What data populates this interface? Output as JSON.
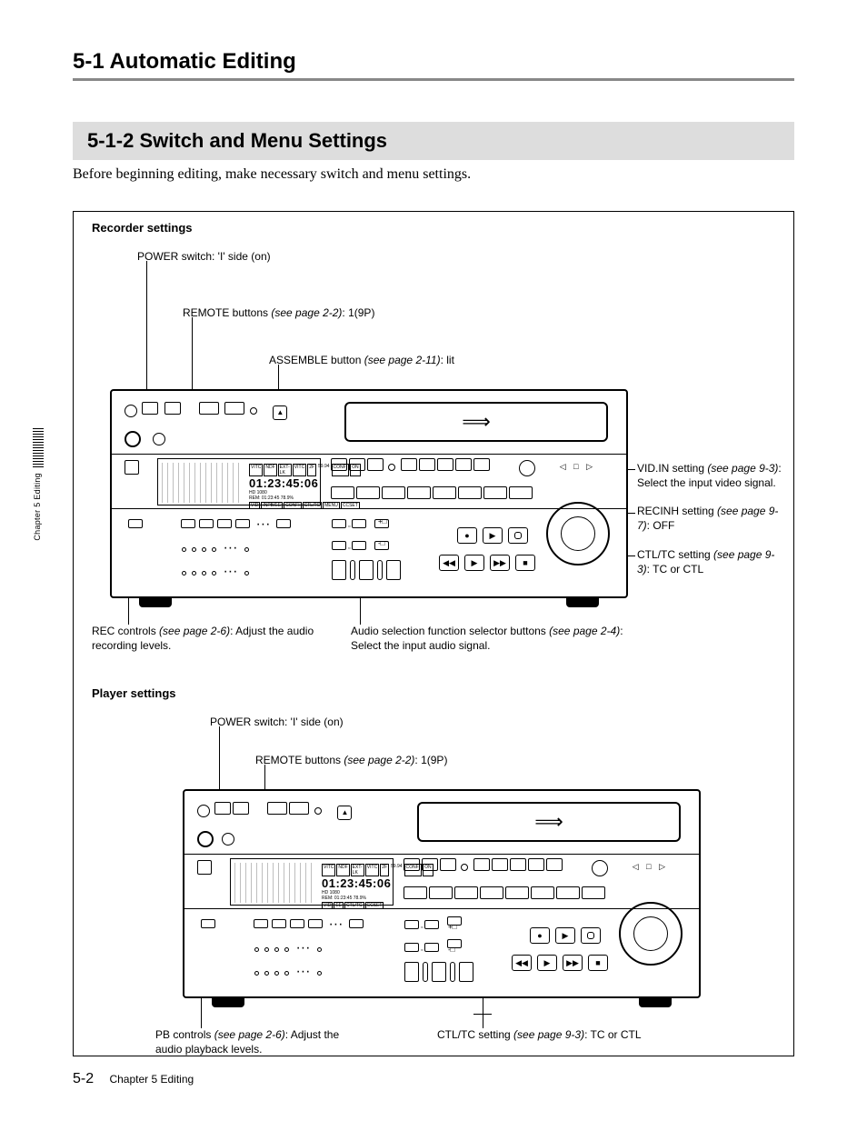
{
  "page": {
    "title": "5-1 Automatic Editing",
    "subsection": "5-1-2 Switch and Menu Settings",
    "intro": "Before beginning editing, make necessary switch and menu settings."
  },
  "recorder": {
    "heading": "Recorder settings",
    "callouts": {
      "power": {
        "text": "POWER switch: 'I' side (on)"
      },
      "remote": {
        "text": "REMOTE buttons ",
        "ref": "(see page 2-2)",
        "tail": ": 1(9P)"
      },
      "assemble": {
        "text": "ASSEMBLE button ",
        "ref": "(see page 2-11)",
        "tail": ": lit"
      },
      "vidin": {
        "text": "VID.IN setting ",
        "ref": "(see page 9-3)",
        "tail": ": Select the input video signal."
      },
      "recinh": {
        "text": "RECINH setting ",
        "ref": "(see page 9-7)",
        "tail": ": OFF"
      },
      "ctltc": {
        "text": "CTL/TC setting ",
        "ref": "(see page 9-3)",
        "tail": ": TC or CTL"
      },
      "rec": {
        "text": "REC controls ",
        "ref": "(see page 2-6)",
        "tail": ": Adjust the audio recording levels."
      },
      "audio": {
        "text": "Audio selection function selector buttons ",
        "ref": "(see page 2-4)",
        "tail": ": Select the input audio signal."
      }
    },
    "display": {
      "timecode": "01:23:45:06",
      "top_tags": [
        "VITC",
        "NDF",
        "EXT-LK",
        "VITC",
        "2F",
        "59.94",
        "",
        "CONFI",
        "ON"
      ],
      "sub": "HD   1080",
      "rem": "REM: 01:23:45   78.9%",
      "bottom_tags": [
        "VID",
        "INPB/EE",
        "CONFI",
        "CTL/TC",
        "MENU",
        "CCSET"
      ]
    }
  },
  "player": {
    "heading": "Player settings",
    "callouts": {
      "power": {
        "text": "POWER switch: 'I' side (on)"
      },
      "remote": {
        "text": "REMOTE buttons ",
        "ref": "(see page 2-2)",
        "tail": ": 1(9P)"
      },
      "pb": {
        "text": "PB controls ",
        "ref": "(see page 2-6)",
        "tail": ": Adjust the audio playback levels."
      },
      "ctltc": {
        "text": "CTL/TC setting ",
        "ref": "(see page 9-3)",
        "tail": ": TC or CTL"
      }
    },
    "display": {
      "timecode": "01:23:45:06",
      "top_tags": [
        "VITC",
        "NDF",
        "EXT-LK",
        "VITC",
        "2F",
        "59.94",
        "",
        "CONFI",
        "ON"
      ],
      "sub": "HD   1080",
      "rem": "REM: 01:23:45   78.9%",
      "bottom_tags": [
        "VID",
        "",
        "EE",
        "",
        "CTL/TC",
        "",
        "CCSET"
      ]
    }
  },
  "side_tab": "Chapter 5  Editing",
  "footer": {
    "page": "5-2",
    "chapter": "Chapter 5  Editing"
  }
}
